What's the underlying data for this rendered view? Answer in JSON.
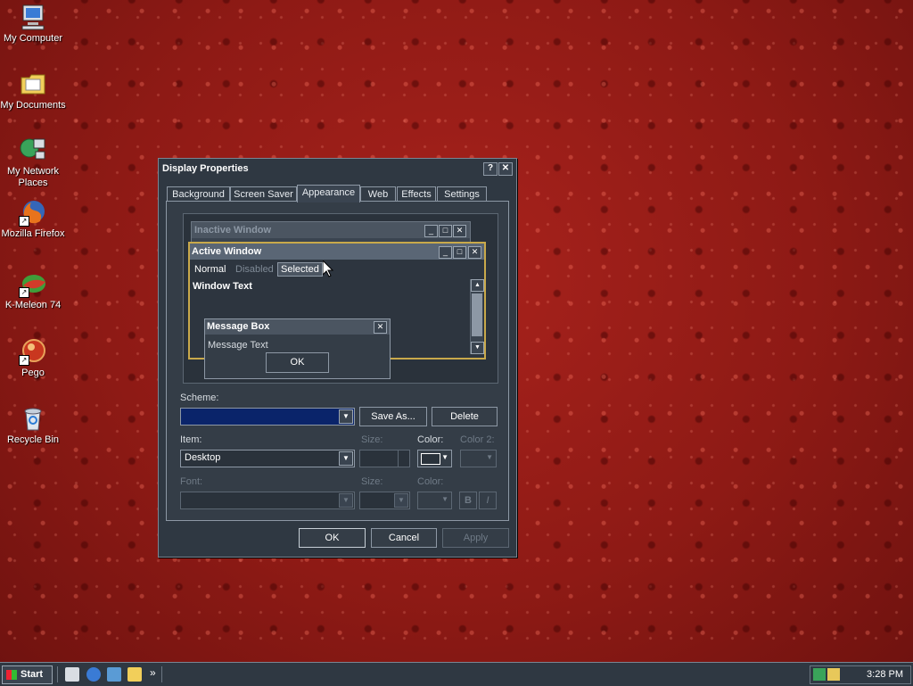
{
  "desktop": {
    "icons": [
      {
        "label": "My Computer",
        "icon": "computer-icon"
      },
      {
        "label": "My Documents",
        "icon": "folder-icon"
      },
      {
        "label": "My Network Places",
        "icon": "network-icon"
      },
      {
        "label": "Mozilla Firefox",
        "icon": "firefox-icon"
      },
      {
        "label": "K-Meleon 74",
        "icon": "kmeleon-icon"
      },
      {
        "label": "Pego",
        "icon": "pego-icon"
      },
      {
        "label": "Recycle Bin",
        "icon": "recycle-bin-icon"
      }
    ]
  },
  "dialog": {
    "title": "Display Properties",
    "help_glyph": "?",
    "close_glyph": "✕",
    "tabs": [
      {
        "label": "Background"
      },
      {
        "label": "Screen Saver"
      },
      {
        "label": "Appearance"
      },
      {
        "label": "Web"
      },
      {
        "label": "Effects"
      },
      {
        "label": "Settings"
      }
    ],
    "active_tab": "Appearance",
    "preview": {
      "inactive_title": "Inactive Window",
      "active_title": "Active Window",
      "menu": {
        "normal": "Normal",
        "disabled": "Disabled",
        "selected": "Selected"
      },
      "window_text": "Window Text",
      "message_box_title": "Message Box",
      "message_text": "Message Text",
      "ok_label": "OK"
    },
    "scheme": {
      "label": "Scheme:",
      "value": "",
      "save_as": "Save As...",
      "delete": "Delete"
    },
    "item": {
      "label": "Item:",
      "value": "Desktop",
      "size_label": "Size:",
      "color_label": "Color:",
      "color2_label": "Color 2:"
    },
    "font": {
      "label": "Font:",
      "size_label": "Size:",
      "color_label": "Color:",
      "bold": "B",
      "italic": "I"
    },
    "buttons": {
      "ok": "OK",
      "cancel": "Cancel",
      "apply": "Apply"
    },
    "colors": {
      "scheme_highlight": "#0a246a",
      "border_accent": "#c9a94b"
    }
  },
  "taskbar": {
    "start_label": "Start",
    "chevron": "»",
    "clock": "3:28 PM"
  }
}
